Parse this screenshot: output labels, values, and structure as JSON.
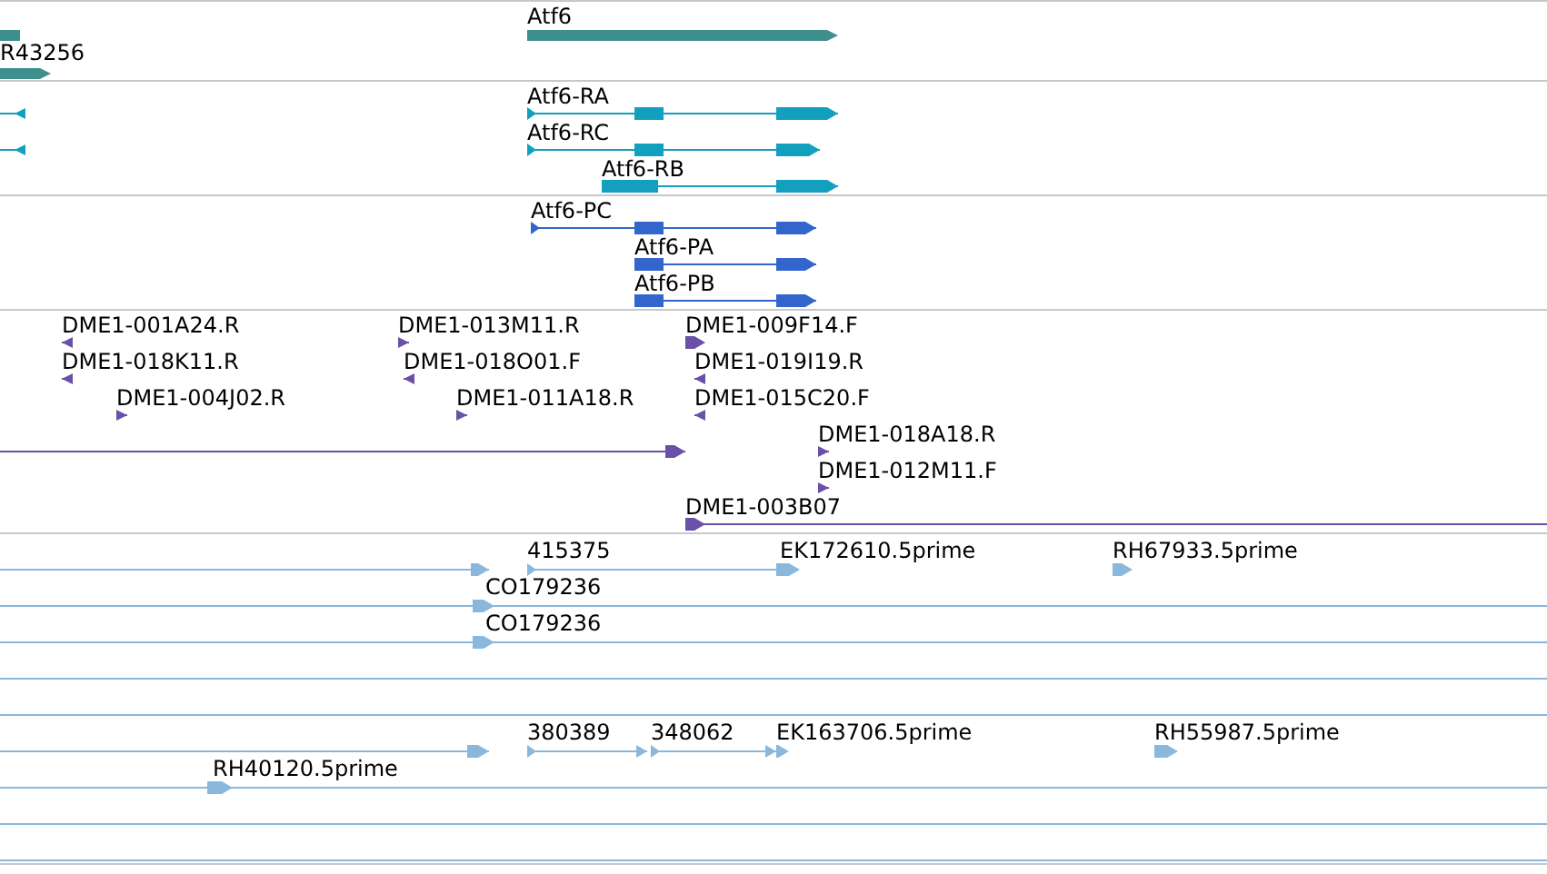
{
  "tracks": [
    {
      "kind": "gene",
      "features": [
        {
          "kind": "plain"
        },
        {
          "label": "R43256",
          "kind": "forward"
        },
        {
          "label": "Atf6",
          "kind": "forward"
        }
      ]
    },
    {
      "kind": "transcript",
      "features": [
        {
          "kind": "reverse"
        },
        {
          "kind": "reverse"
        },
        {
          "label": "Atf6-RA",
          "kind": "forward"
        },
        {
          "label": "Atf6-RC",
          "kind": "forward"
        },
        {
          "label": "Atf6-RB",
          "kind": "forward"
        }
      ]
    },
    {
      "kind": "protein",
      "features": [
        {
          "label": "Atf6-PC",
          "kind": "forward"
        },
        {
          "label": "Atf6-PA",
          "kind": "forward"
        },
        {
          "label": "Atf6-PB",
          "kind": "forward"
        }
      ]
    },
    {
      "kind": "probe",
      "features": [
        {
          "label": "DME1-001A24.R",
          "kind": "reverse"
        },
        {
          "label": "DME1-018K11.R",
          "kind": "reverse"
        },
        {
          "label": "DME1-004J02.R",
          "kind": "forward"
        },
        {
          "label": "DME1-013M11.R",
          "kind": "forward"
        },
        {
          "label": "DME1-018O01.F",
          "kind": "reverse"
        },
        {
          "label": "DME1-011A18.R",
          "kind": "forward"
        },
        {
          "kind": "forward"
        },
        {
          "label": "DME1-009F14.F",
          "kind": "forward"
        },
        {
          "label": "DME1-019I19.R",
          "kind": "reverse"
        },
        {
          "label": "DME1-015C20.F",
          "kind": "reverse"
        },
        {
          "label": "DME1-018A18.R",
          "kind": "forward"
        },
        {
          "label": "DME1-012M11.F",
          "kind": "forward"
        },
        {
          "label": "DME1-003B07",
          "kind": "forward"
        }
      ]
    },
    {
      "kind": "est",
      "features": [
        {
          "kind": "forward"
        },
        {
          "label": "415375",
          "kind": "forward"
        },
        {
          "label": "EK172610.5prime",
          "kind": "forward"
        },
        {
          "label": "RH67933.5prime",
          "kind": "forward"
        },
        {
          "label": "CO179236",
          "kind": "forward"
        },
        {
          "label": "CO179236",
          "kind": "forward"
        },
        {
          "kind": "plain"
        },
        {
          "kind": "plain"
        },
        {
          "kind": "forward"
        },
        {
          "label": "380389",
          "kind": "forward"
        },
        {
          "label": "348062",
          "kind": "forward"
        },
        {
          "label": "EK163706.5prime",
          "kind": "forward"
        },
        {
          "label": "RH55987.5prime",
          "kind": "forward"
        },
        {
          "label": "RH40120.5prime",
          "kind": "forward"
        },
        {
          "kind": "plain"
        },
        {
          "kind": "plain"
        }
      ]
    }
  ]
}
